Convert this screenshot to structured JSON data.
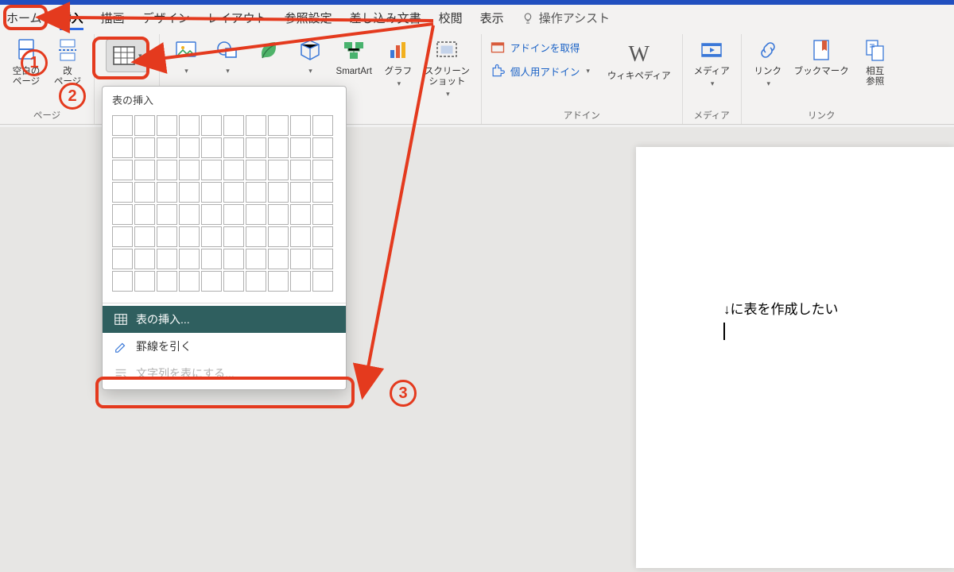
{
  "tabs": {
    "items": [
      "ホーム",
      "挿入",
      "描画",
      "デザイン",
      "レイアウト",
      "参照設定",
      "差し込み文書",
      "校閲",
      "表示"
    ],
    "active_index": 1,
    "assist_label": "操作アシスト"
  },
  "ribbon": {
    "pages_group": {
      "blank": "空白の\nページ",
      "break_": "改\nページ",
      "label": "ページ"
    },
    "table_group": {
      "label": "",
      "caret": "▾"
    },
    "illust_group": {},
    "smartart": "SmartArt",
    "graph": "グラフ",
    "screenshot": "スクリーン\nショット",
    "addins": {
      "get": "アドインを取得",
      "my": "個人用アドイン",
      "wiki": "ウィキペディア",
      "group_label": "アドイン"
    },
    "media": {
      "btn": "メディア",
      "group_label": "メディア"
    },
    "links": {
      "link": "リンク",
      "bookmark": "ブックマーク",
      "crossref": "相互\n参照",
      "group_label": "リンク"
    }
  },
  "dropdown": {
    "title": "表の挿入",
    "insert": "表の挿入...",
    "draw": "罫線を引く",
    "convert": "文字列を表にする..."
  },
  "document": {
    "line1": "↓に表を作成したい"
  },
  "annotations": {
    "n1": "1",
    "n2": "2",
    "n3": "3"
  },
  "icons": {
    "table": "table-icon",
    "search_bulb": "bulb-icon"
  }
}
